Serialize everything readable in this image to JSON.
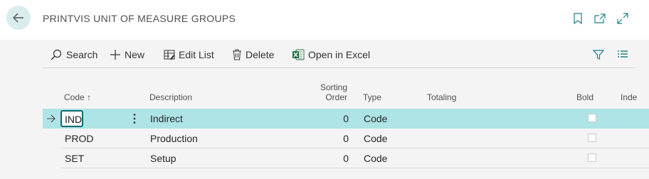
{
  "header": {
    "title": "PRINTVIS UNIT OF MEASURE GROUPS"
  },
  "actions": {
    "search": "Search",
    "new": "New",
    "edit_list": "Edit List",
    "delete": "Delete",
    "open_in_excel": "Open in Excel"
  },
  "columns": {
    "code": "Code",
    "sort_indicator": "↑",
    "description": "Description",
    "sorting_order_line1": "Sorting",
    "sorting_order_line2": "Order",
    "type": "Type",
    "totaling": "Totaling",
    "bold": "Bold",
    "indent": "Inde"
  },
  "rows": [
    {
      "code": "IND",
      "description": "Indirect",
      "sorting_order": "0",
      "type": "Code",
      "bold": false
    },
    {
      "code": "PROD",
      "description": "Production",
      "sorting_order": "0",
      "type": "Code",
      "bold": false
    },
    {
      "code": "SET",
      "description": "Setup",
      "sorting_order": "0",
      "type": "Code",
      "bold": false
    }
  ],
  "colors": {
    "accent": "#0b6b73",
    "selected_row": "#aee4e6",
    "back_button": "#d9ecee"
  }
}
